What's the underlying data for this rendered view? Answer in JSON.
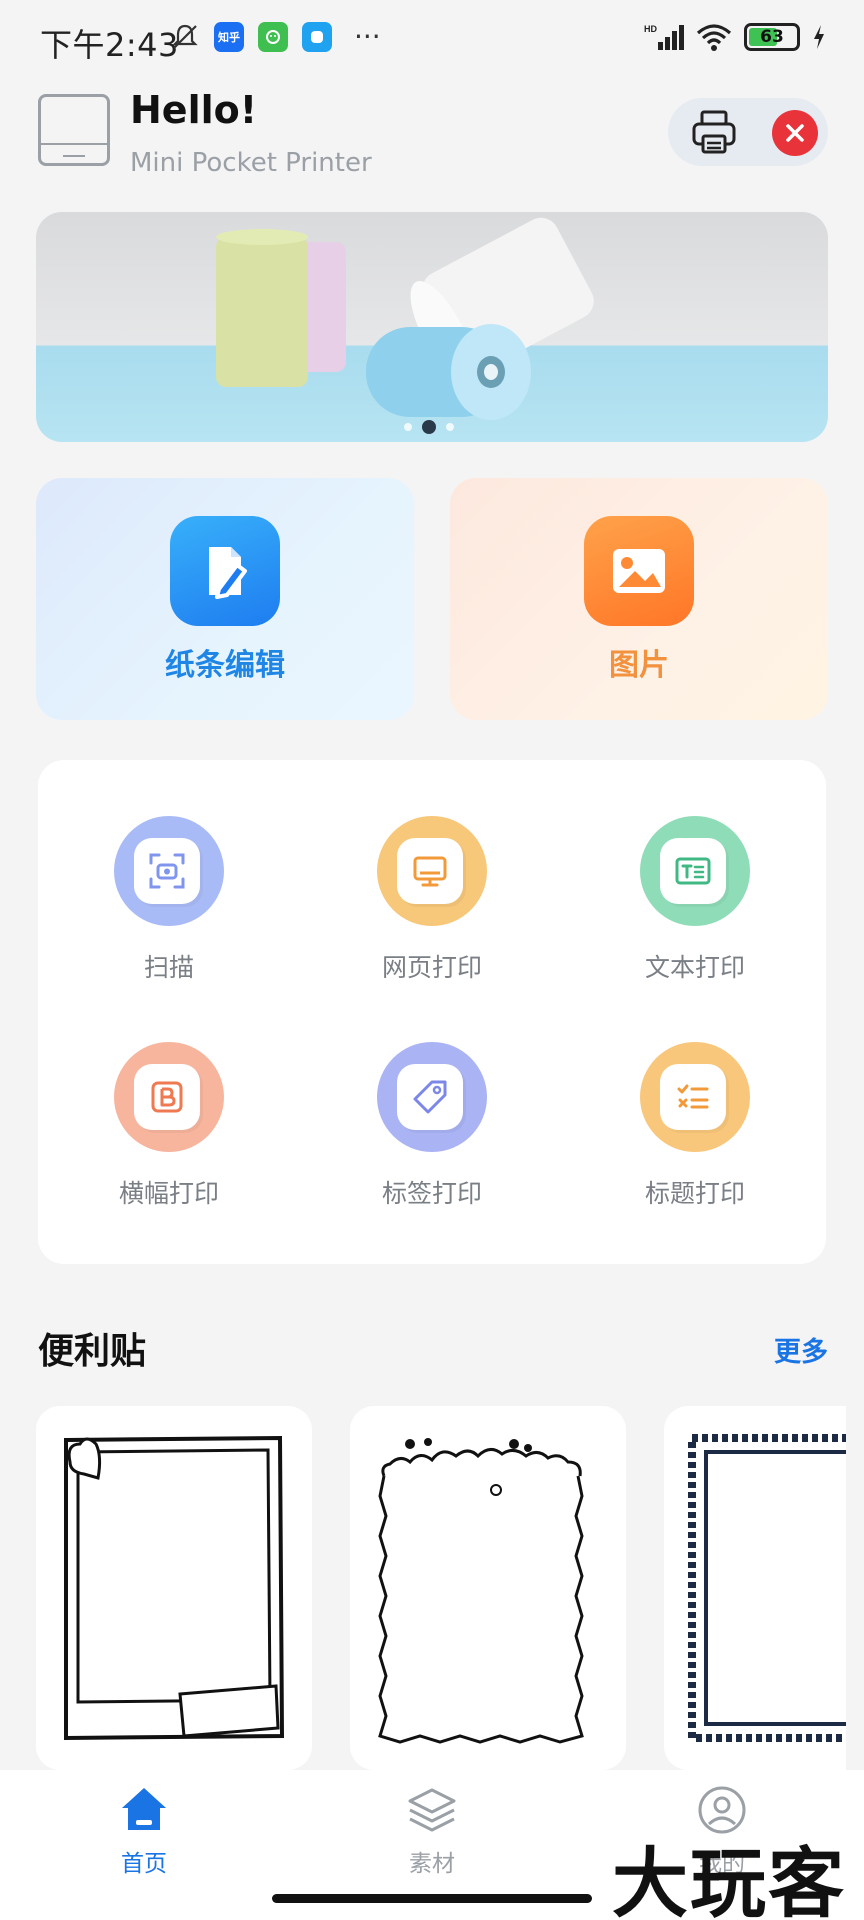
{
  "status_bar": {
    "time": "下午2:43",
    "apps": [
      "知乎",
      "",
      ""
    ],
    "more": "···",
    "network": "HD",
    "battery": "63",
    "battery_level": 0.63
  },
  "header": {
    "greeting": "Hello!",
    "device_name": "Mini Pocket Printer"
  },
  "banner": {
    "slide_count": 3,
    "active_slide": 2
  },
  "features": [
    {
      "label": "纸条编辑",
      "icon": "note-edit-icon"
    },
    {
      "label": "图片",
      "icon": "image-icon"
    }
  ],
  "tools": [
    {
      "label": "扫描",
      "icon": "scan-icon",
      "color": "#a9bbf7"
    },
    {
      "label": "网页打印",
      "icon": "monitor-icon",
      "color": "#f7c77a"
    },
    {
      "label": "文本打印",
      "icon": "text-icon",
      "color": "#8fdcb8"
    },
    {
      "label": "横幅打印",
      "icon": "banner-b-icon",
      "color": "#f7b59e"
    },
    {
      "label": "标签打印",
      "icon": "tag-icon",
      "color": "#aab3f4"
    },
    {
      "label": "标题打印",
      "icon": "checklist-icon",
      "color": "#f9c77b"
    }
  ],
  "section": {
    "title": "便利贴",
    "more": "更多"
  },
  "stickers": [
    "polaroid-frame",
    "scalloped-frame",
    "stamp-frame"
  ],
  "nav": {
    "items": [
      {
        "label": "首页",
        "icon": "home-icon"
      },
      {
        "label": "素材",
        "icon": "layers-icon"
      },
      {
        "label": "我的",
        "icon": "profile-icon"
      }
    ]
  },
  "watermark": "大玩客",
  "colors": {
    "accent": "#1a74e4",
    "close": "#e8333a"
  }
}
